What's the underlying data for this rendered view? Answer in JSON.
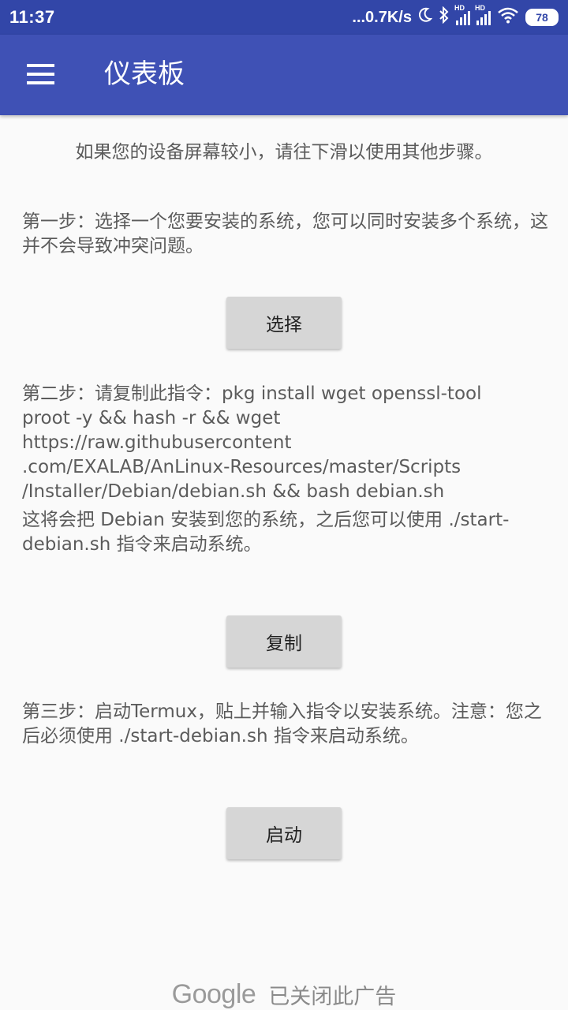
{
  "status_bar": {
    "time": "11:37",
    "network_speed": "...0.7K/s",
    "signal_labels": [
      "HD",
      "HD"
    ],
    "battery": "78"
  },
  "app_bar": {
    "title": "仪表板"
  },
  "content": {
    "hint": "如果您的设备屏幕较小，请往下滑以使用其他步骤。",
    "step1": "第一步：选择一个您要安装的系统，您可以同时安装多个系统，这并不会导致冲突问题。",
    "select_button": "选择",
    "step2_line1": "第二步：请复制此指令：pkg install wget openssl-tool",
    "step2_line2": "proot -y && hash -r && wget https://raw.githubusercontent",
    "step2_line3": ".com/EXALAB/AnLinux-Resources/master/Scripts",
    "step2_line4": "/Installer/Debian/debian.sh && bash debian.sh",
    "step2_note": "这将会把 Debian 安装到您的系统，之后您可以使用 ./start-debian.sh 指令来启动系统。",
    "copy_button": "复制",
    "step3": "第三步：启动Termux，贴上并输入指令以安装系统。注意：您之后必须使用 ./start-debian.sh 指令来启动系统。",
    "launch_button": "启动"
  },
  "ad_bar": {
    "brand": "Google",
    "text": "已关闭此广告"
  },
  "colors": {
    "status_bar": "#3246a8",
    "app_bar": "#3f51b5",
    "background": "#fafafa",
    "button": "#d6d6d6",
    "text": "#5b5b5b"
  }
}
